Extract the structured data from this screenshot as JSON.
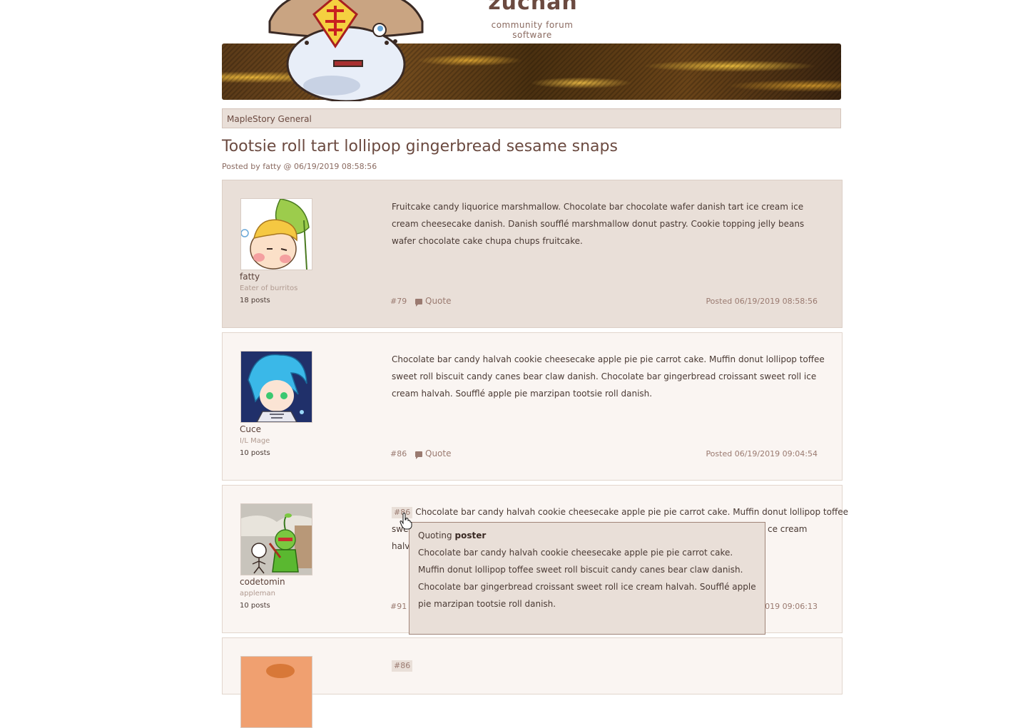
{
  "site": {
    "title": "zuchan",
    "subtitle": "community forum software"
  },
  "breadcrumb": "MapleStory General",
  "thread": {
    "title": "Tootsie roll tart lollipop gingerbread sesame snaps",
    "meta": "Posted by fatty @ 06/19/2019 08:58:56"
  },
  "posts": [
    {
      "username": "fatty",
      "user_title": "Eater of burritos",
      "post_count": "18 posts",
      "body": "Fruitcake candy liquorice marshmallow. Chocolate bar chocolate wafer danish tart ice cream ice cream cheesecake danish. Danish soufflé marshmallow donut pastry. Cookie topping jelly beans wafer chocolate cake chupa chups fruitcake.",
      "number": "#79",
      "quote_label": "Quote",
      "posted": "Posted 06/19/2019 08:58:56"
    },
    {
      "username": "Cuce",
      "user_title": "I/L Mage",
      "post_count": "10 posts",
      "body": "Chocolate bar candy halvah cookie cheesecake apple pie pie carrot cake. Muffin donut lollipop toffee sweet roll biscuit candy canes bear claw danish. Chocolate bar gingerbread croissant sweet roll ice cream halvah. Soufflé apple pie marzipan tootsie roll danish.",
      "number": "#86",
      "quote_label": "Quote",
      "posted": "Posted 06/19/2019 09:04:54"
    },
    {
      "username": "codetomin",
      "user_title": "appleman",
      "post_count": "10 posts",
      "ref": "#86",
      "line1": "Chocolate bar candy halvah cookie cheesecake apple pie pie carrot cake. Muffin donut lollipop toffee",
      "line2_start": "swe",
      "line2_end": "ce cream",
      "line3_start": "halva",
      "number": "#91",
      "posted_fragment": "/2019 09:06:13"
    },
    {
      "ref": "#86"
    }
  ],
  "tooltip": {
    "prefix": "Quoting",
    "author": "poster",
    "text": "Chocolate bar candy halvah cookie cheesecake apple pie pie carrot cake. Muffin donut lollipop toffee sweet roll biscuit candy canes bear claw danish. Chocolate bar gingerbread croissant sweet roll ice cream halvah. Soufflé apple pie marzipan tootsie roll danish."
  }
}
